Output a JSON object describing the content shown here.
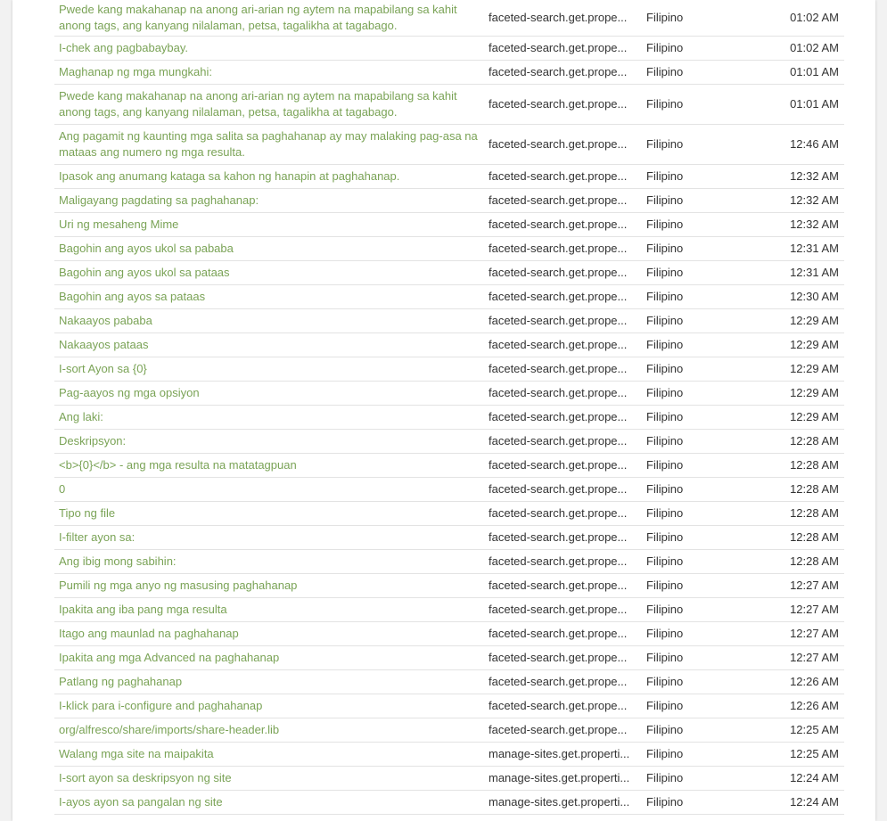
{
  "colors": {
    "link": "#7aa356",
    "text": "#333333",
    "divider": "#e3e3e3"
  },
  "rows": [
    {
      "text": "Pwede kang makahanap na anong ari-arian ng aytem na mapabilang sa kahit anong tags, ang kanyang nilalaman, petsa, tagalikha at tagabago.",
      "key": "faceted-search.get.prope...",
      "lang": "Filipino",
      "time": "01:02 AM"
    },
    {
      "text": "I-chek ang pagbabaybay.",
      "key": "faceted-search.get.prope...",
      "lang": "Filipino",
      "time": "01:02 AM"
    },
    {
      "text": "Maghanap ng mga mungkahi:",
      "key": "faceted-search.get.prope...",
      "lang": "Filipino",
      "time": "01:01 AM"
    },
    {
      "text": "Pwede kang makahanap na anong ari-arian ng aytem na mapabilang sa kahit anong tags, ang kanyang nilalaman, petsa, tagalikha at tagabago.",
      "key": "faceted-search.get.prope...",
      "lang": "Filipino",
      "time": "01:01 AM"
    },
    {
      "text": "Ang pagamit ng kaunting mga salita sa paghahanap ay may malaking pag-asa na mataas ang numero ng mga resulta.",
      "key": "faceted-search.get.prope...",
      "lang": "Filipino",
      "time": "12:46 AM"
    },
    {
      "text": "Ipasok ang anumang kataga sa kahon ng hanapin at paghahanap.",
      "key": "faceted-search.get.prope...",
      "lang": "Filipino",
      "time": "12:32 AM"
    },
    {
      "text": "Maligayang pagdating sa paghahanap:",
      "key": "faceted-search.get.prope...",
      "lang": "Filipino",
      "time": "12:32 AM"
    },
    {
      "text": "Uri ng mesaheng Mime",
      "key": "faceted-search.get.prope...",
      "lang": "Filipino",
      "time": "12:32 AM"
    },
    {
      "text": "Bagohin ang ayos ukol sa pababa",
      "key": "faceted-search.get.prope...",
      "lang": "Filipino",
      "time": "12:31 AM"
    },
    {
      "text": "Bagohin ang ayos ukol sa pataas",
      "key": "faceted-search.get.prope...",
      "lang": "Filipino",
      "time": "12:31 AM"
    },
    {
      "text": "Bagohin ang ayos sa pataas",
      "key": "faceted-search.get.prope...",
      "lang": "Filipino",
      "time": "12:30 AM"
    },
    {
      "text": "Nakaayos pababa",
      "key": "faceted-search.get.prope...",
      "lang": "Filipino",
      "time": "12:29 AM"
    },
    {
      "text": "Nakaayos pataas",
      "key": "faceted-search.get.prope...",
      "lang": "Filipino",
      "time": "12:29 AM"
    },
    {
      "text": "I-sort Ayon sa {0}",
      "key": "faceted-search.get.prope...",
      "lang": "Filipino",
      "time": "12:29 AM"
    },
    {
      "text": "Pag-aayos ng mga opsiyon",
      "key": "faceted-search.get.prope...",
      "lang": "Filipino",
      "time": "12:29 AM"
    },
    {
      "text": "Ang laki:",
      "key": "faceted-search.get.prope...",
      "lang": "Filipino",
      "time": "12:29 AM"
    },
    {
      "text": "Deskripsyon:",
      "key": "faceted-search.get.prope...",
      "lang": "Filipino",
      "time": "12:28 AM"
    },
    {
      "text": "<b>{0}</b> - ang mga resulta na matatagpuan",
      "key": "faceted-search.get.prope...",
      "lang": "Filipino",
      "time": "12:28 AM"
    },
    {
      "text": "0",
      "key": "faceted-search.get.prope...",
      "lang": "Filipino",
      "time": "12:28 AM"
    },
    {
      "text": "Tipo ng file",
      "key": "faceted-search.get.prope...",
      "lang": "Filipino",
      "time": "12:28 AM"
    },
    {
      "text": "I-filter ayon sa:",
      "key": "faceted-search.get.prope...",
      "lang": "Filipino",
      "time": "12:28 AM"
    },
    {
      "text": "Ang ibig mong sabihin:",
      "key": "faceted-search.get.prope...",
      "lang": "Filipino",
      "time": "12:28 AM"
    },
    {
      "text": "Pumili ng mga anyo ng masusing paghahanap",
      "key": "faceted-search.get.prope...",
      "lang": "Filipino",
      "time": "12:27 AM"
    },
    {
      "text": "Ipakita ang iba pang mga resulta",
      "key": "faceted-search.get.prope...",
      "lang": "Filipino",
      "time": "12:27 AM"
    },
    {
      "text": "Itago ang maunlad na paghahanap",
      "key": "faceted-search.get.prope...",
      "lang": "Filipino",
      "time": "12:27 AM"
    },
    {
      "text": "Ipakita ang mga Advanced na paghahanap",
      "key": "faceted-search.get.prope...",
      "lang": "Filipino",
      "time": "12:27 AM"
    },
    {
      "text": "Patlang ng paghahanap",
      "key": "faceted-search.get.prope...",
      "lang": "Filipino",
      "time": "12:26 AM"
    },
    {
      "text": "I-klick para i-configure and paghahanap",
      "key": "faceted-search.get.prope...",
      "lang": "Filipino",
      "time": "12:26 AM"
    },
    {
      "text": "org/alfresco/share/imports/share-header.lib",
      "key": "faceted-search.get.prope...",
      "lang": "Filipino",
      "time": "12:25 AM"
    },
    {
      "text": "Walang mga site na maipakita",
      "key": "manage-sites.get.properti...",
      "lang": "Filipino",
      "time": "12:25 AM"
    },
    {
      "text": "I-sort ayon sa deskripsyon ng site",
      "key": "manage-sites.get.properti...",
      "lang": "Filipino",
      "time": "12:24 AM"
    },
    {
      "text": "I-ayos ayon sa pangalan ng site",
      "key": "manage-sites.get.properti...",
      "lang": "Filipino",
      "time": "12:24 AM"
    }
  ]
}
